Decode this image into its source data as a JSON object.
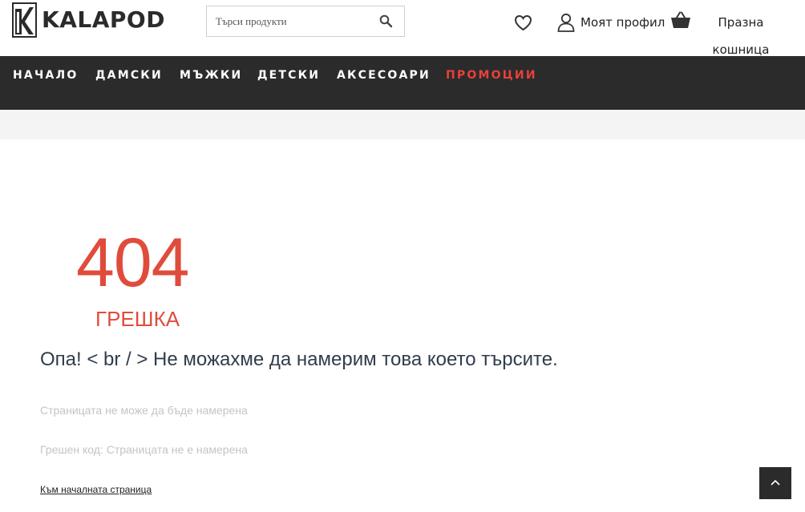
{
  "header": {
    "brand": "KALAPOD",
    "search_placeholder": "Търси продукти",
    "profile_label": "Моят профил",
    "cart_label": "Празна кошница",
    "icons": [
      "logo-mark-icon",
      "search-icon",
      "heart-icon",
      "user-icon",
      "basket-icon"
    ]
  },
  "nav": {
    "items": [
      {
        "label": "НАЧАЛО"
      },
      {
        "label": "ДАМСКИ"
      },
      {
        "label": "МЪЖКИ"
      },
      {
        "label": "ДЕТСКИ"
      },
      {
        "label": "АКСЕСОАРИ"
      },
      {
        "label": "ПРОМОЦИИ"
      }
    ],
    "promo_color": "#e8413a"
  },
  "error": {
    "code": "404",
    "label": "ГРЕШКА",
    "message": "Опа! < br / > Не можахме да намерим това което търсите.",
    "info_1": "Страницата не може да бъде намерена",
    "info_2": "Грешен код: Страницата не е намерена",
    "home_link": "Към началната страница",
    "accent_color": "#e04c3c"
  },
  "colors": {
    "nav_bg": "#2b2b2b",
    "accent": "#e04c3c"
  }
}
